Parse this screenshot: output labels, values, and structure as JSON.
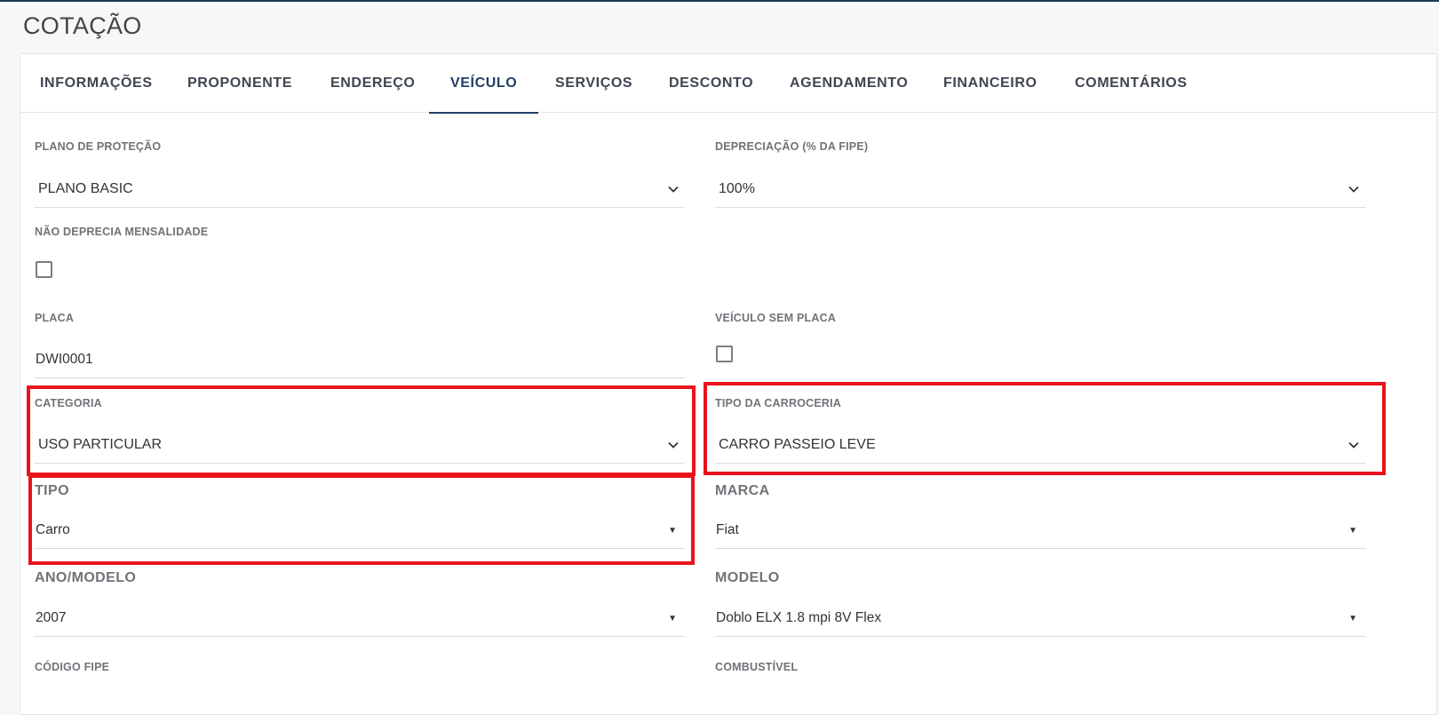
{
  "page": {
    "title": "COTAÇÃO"
  },
  "tabs": [
    {
      "label": "INFORMAÇÕES"
    },
    {
      "label": "PROPONENTE"
    },
    {
      "label": "ENDEREÇO"
    },
    {
      "label": "VEÍCULO",
      "active": true
    },
    {
      "label": "SERVIÇOS"
    },
    {
      "label": "DESCONTO"
    },
    {
      "label": "AGENDAMENTO"
    },
    {
      "label": "FINANCEIRO"
    },
    {
      "label": "COMENTÁRIOS"
    }
  ],
  "form": {
    "plano_protecao": {
      "label": "PLANO DE PROTEÇÃO",
      "value": "PLANO BASIC"
    },
    "depreciacao": {
      "label": "DEPRECIAÇÃO (% DA FIPE)",
      "value": "100%"
    },
    "nao_deprecia": {
      "label": "NÃO DEPRECIA MENSALIDADE",
      "checked": false
    },
    "placa": {
      "label": "PLACA",
      "value": "DWI0001"
    },
    "sem_placa": {
      "label": "VEÍCULO SEM PLACA",
      "checked": false
    },
    "categoria": {
      "label": "CATEGORIA",
      "value": "USO PARTICULAR"
    },
    "carroceria": {
      "label": "TIPO DA CARROCERIA",
      "value": "CARRO PASSEIO LEVE"
    },
    "tipo": {
      "label": "TIPO",
      "value": "Carro"
    },
    "marca": {
      "label": "MARCA",
      "value": "Fiat"
    },
    "ano_modelo": {
      "label": "ANO/MODELO",
      "value": "2007"
    },
    "modelo": {
      "label": "MODELO",
      "value": "Doblo ELX 1.8 mpi 8V Flex"
    },
    "codigo_fipe": {
      "label": "CÓDIGO FIPE"
    },
    "combustivel": {
      "label": "COMBUSTÍVEL"
    }
  },
  "colors": {
    "accent": "#1f3f66",
    "highlight": "#e8131c"
  },
  "icons": {
    "select": "chevron-down-icon",
    "native_select": "caret-down-icon"
  }
}
